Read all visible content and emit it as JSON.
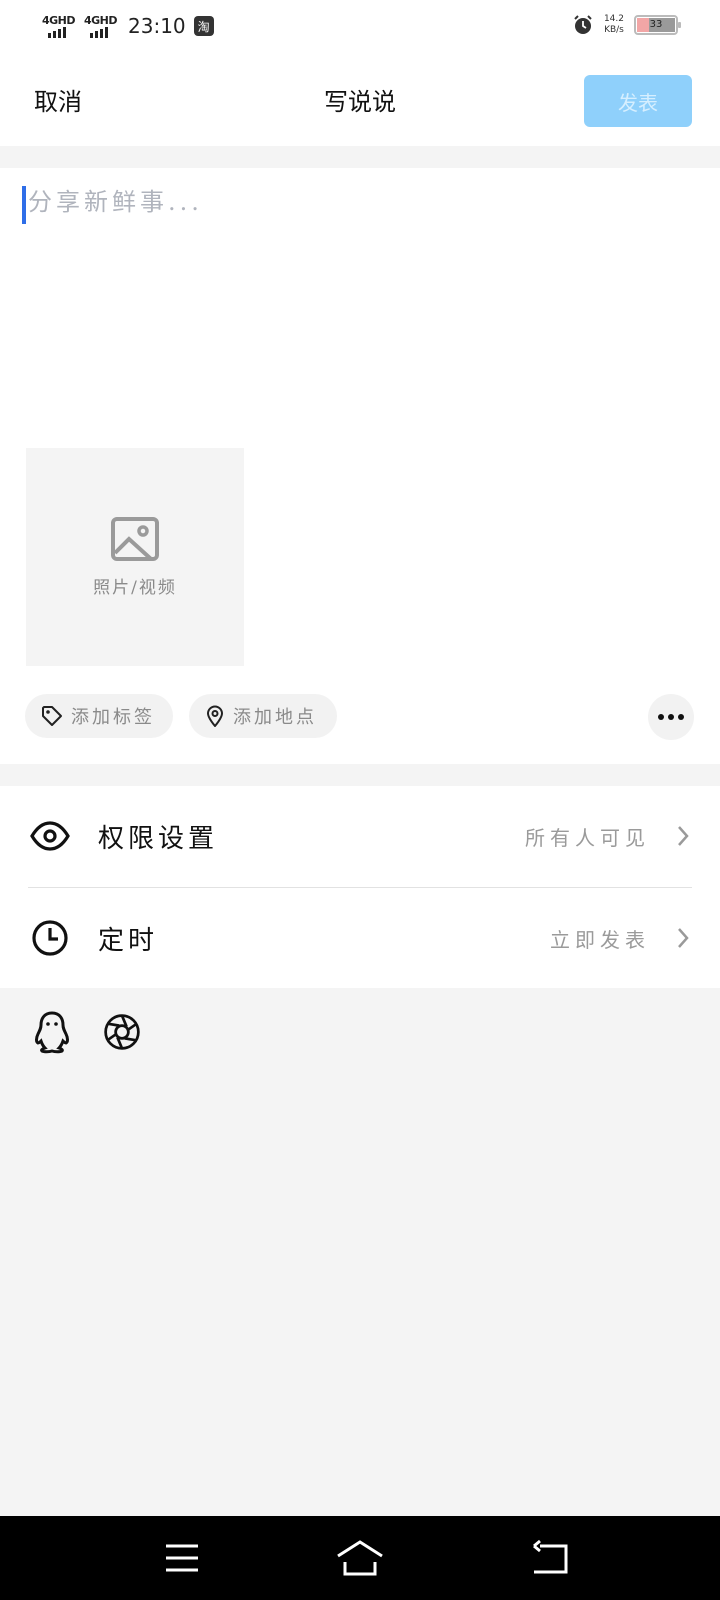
{
  "status_bar": {
    "signal1": "4GHD",
    "signal2": "4GHD",
    "time": "23:10",
    "app_badge": "淘",
    "net_speed": "14.2",
    "net_unit": "KB/s",
    "battery": "33"
  },
  "header": {
    "cancel_label": "取消",
    "title": "写说说",
    "publish_label": "发表"
  },
  "compose": {
    "placeholder": "分享新鲜事...",
    "media_label": "照片/视频",
    "tag_label": "添加标签",
    "location_label": "添加地点"
  },
  "settings": {
    "permission": {
      "label": "权限设置",
      "value": "所有人可见"
    },
    "schedule": {
      "label": "定时",
      "value": "立即发表"
    }
  },
  "colors": {
    "accent": "#8fd0fb",
    "cursor": "#2f6ee8"
  }
}
